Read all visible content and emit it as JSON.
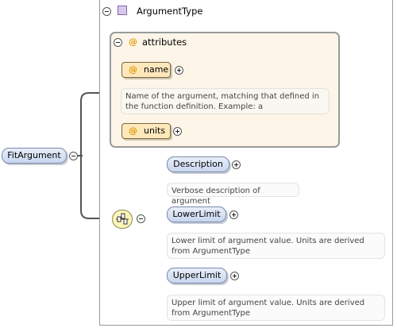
{
  "root_element": {
    "label": "FitArgument"
  },
  "type": {
    "label": "ArgumentType"
  },
  "attributes": {
    "label": "attributes",
    "items": [
      {
        "label": "name",
        "doc": "Name of the argument, matching that defined in the function definition. Example: a"
      },
      {
        "label": "units",
        "doc": ""
      }
    ]
  },
  "sequence": {
    "items": [
      {
        "label": "Description",
        "doc": "Verbose description of argument"
      },
      {
        "label": "LowerLimit",
        "doc": "Lower limit of argument value. Units are derived from ArgumentType"
      },
      {
        "label": "UpperLimit",
        "doc": "Upper limit of argument value. Units are derived from ArgumentType"
      }
    ]
  },
  "icons": {
    "attribute": "@"
  },
  "colors": {
    "element_fill": "#c8d6ee",
    "attribute_fill": "#fde8bc",
    "attribute_panel": "#fdf6e8",
    "sequence_fill": "#fdf5b8",
    "type_icon": "#d8c8ec"
  }
}
